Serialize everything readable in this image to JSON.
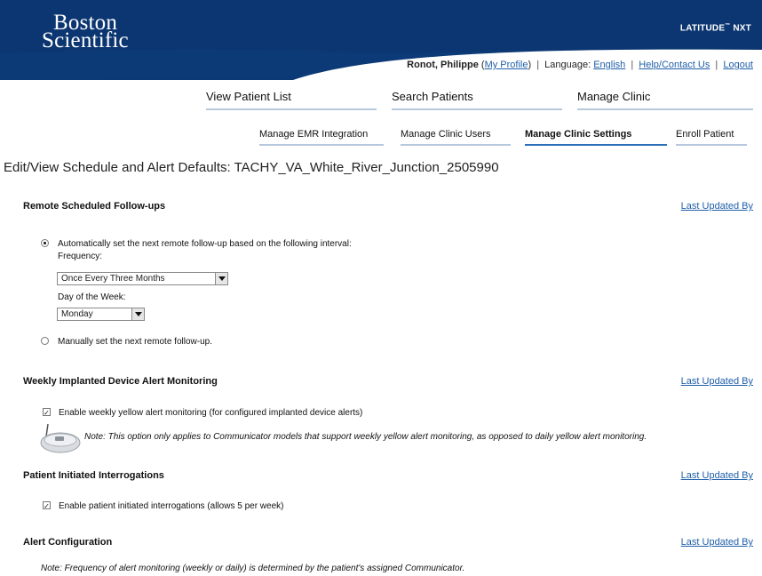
{
  "header": {
    "logo_line1": "Boston",
    "logo_line2": "Scientific",
    "product_name": "LATITUDE",
    "product_tm": "™",
    "product_suffix": " NXT",
    "user_name": "Ronot, Philippe",
    "my_profile": "My Profile",
    "language_label": "Language:",
    "language_value": "English",
    "help": "Help/Contact Us",
    "logout": "Logout",
    "band_color": "#0d3a75"
  },
  "primary_nav": [
    "View Patient List",
    "Search Patients",
    "Manage Clinic"
  ],
  "secondary_nav": {
    "items": [
      "Manage EMR Integration",
      "Manage Clinic Users",
      "Manage Clinic Settings",
      "Enroll Patient"
    ],
    "active": "Manage Clinic Settings"
  },
  "page_title": "Edit/View Schedule and Alert Defaults: TACHY_VA_White_River_Junction_2505990",
  "sections": {
    "remote": {
      "title": "Remote Scheduled Follow-ups",
      "link": "Last Updated By",
      "auto_label": "Automatically set the next remote follow-up based on the following interval:",
      "frequency_label": "Frequency:",
      "frequency_value": "Once Every Three Months",
      "day_label": "Day of the Week:",
      "day_value": "Monday",
      "manual_label": "Manually set the next remote follow-up."
    },
    "weekly": {
      "title": "Weekly Implanted Device Alert Monitoring",
      "link": "Last Updated By",
      "checkbox_label": "Enable weekly yellow alert monitoring (for configured implanted device alerts)",
      "note": "Note: This option only applies to Communicator models that support weekly yellow alert monitoring, as opposed to daily yellow alert monitoring.",
      "device_icon": "communicator-device-icon"
    },
    "patient": {
      "title": "Patient Initiated Interrogations",
      "link": "Last Updated By",
      "checkbox_label": "Enable patient initiated interrogations (allows 5 per week)"
    },
    "alert": {
      "title": "Alert Configuration",
      "link": "Last Updated By",
      "note": "Note: Frequency of alert monitoring (weekly or daily) is determined by the patient's assigned Communicator."
    }
  }
}
